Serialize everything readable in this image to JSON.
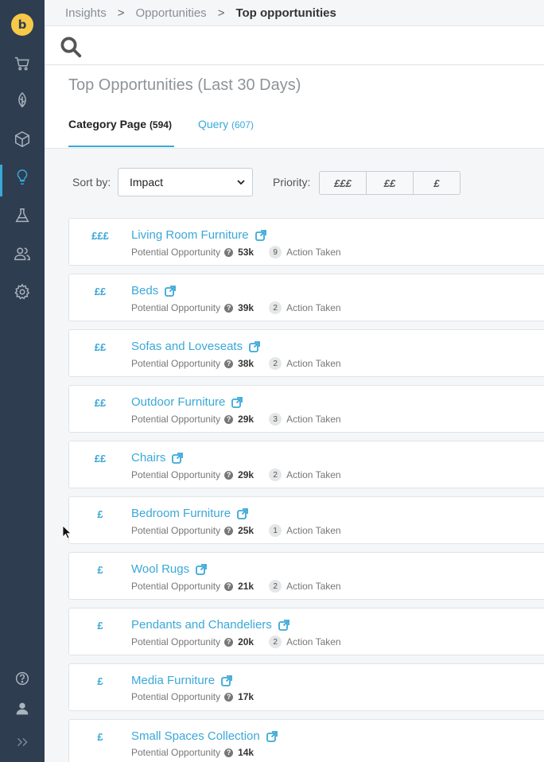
{
  "breadcrumb": [
    "Insights",
    "Opportunities",
    "Top opportunities"
  ],
  "page_title": "Top Opportunities (Last 30 Days)",
  "tabs": [
    {
      "label": "Category Page",
      "count": "(594)"
    },
    {
      "label": "Query",
      "count": "(607)"
    }
  ],
  "sort": {
    "label": "Sort by:",
    "selected": "Impact"
  },
  "priority": {
    "label": "Priority:",
    "options": [
      "£££",
      "££",
      "£"
    ]
  },
  "meta_label": "Potential Opportunity",
  "action_label": "Action Taken",
  "items": [
    {
      "priority": "£££",
      "name": "Living Room Furniture",
      "value": "53k",
      "actions": "9"
    },
    {
      "priority": "££",
      "name": "Beds",
      "value": "39k",
      "actions": "2"
    },
    {
      "priority": "££",
      "name": "Sofas and Loveseats",
      "value": "38k",
      "actions": "2"
    },
    {
      "priority": "££",
      "name": "Outdoor Furniture",
      "value": "29k",
      "actions": "3"
    },
    {
      "priority": "££",
      "name": "Chairs",
      "value": "29k",
      "actions": "2"
    },
    {
      "priority": "£",
      "name": "Bedroom Furniture",
      "value": "25k",
      "actions": "1"
    },
    {
      "priority": "£",
      "name": "Wool Rugs",
      "value": "21k",
      "actions": "2"
    },
    {
      "priority": "£",
      "name": "Pendants and Chandeliers",
      "value": "20k",
      "actions": "2"
    },
    {
      "priority": "£",
      "name": "Media Furniture",
      "value": "17k",
      "actions": null
    },
    {
      "priority": "£",
      "name": "Small Spaces Collection",
      "value": "14k",
      "actions": null
    }
  ],
  "icons": {
    "sidebar": [
      "cart-icon",
      "leaf-icon",
      "box-icon",
      "lightbulb-icon",
      "flask-icon",
      "users-icon",
      "gear-icon",
      "help-icon",
      "user-icon",
      "expand-icon"
    ],
    "colors": {
      "sidebar": "#2e3d50",
      "accent": "#3aa8d8",
      "logo": "#f7c948"
    }
  }
}
